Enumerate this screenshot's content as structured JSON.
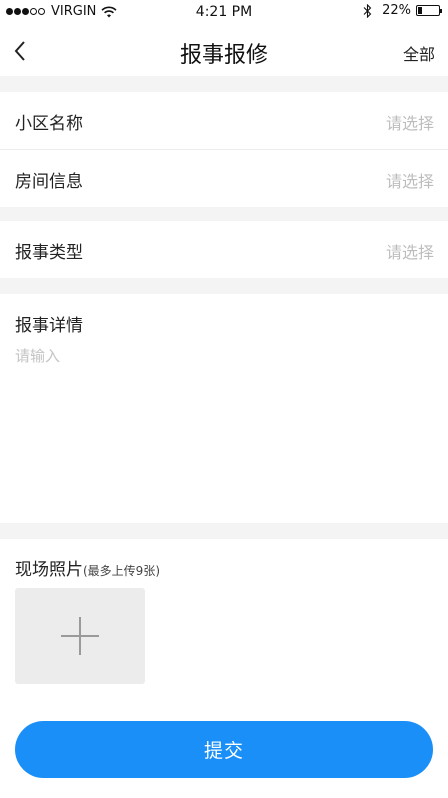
{
  "status_bar": {
    "carrier": "VIRGIN",
    "time": "4:21 PM",
    "battery": "22%",
    "battery_level": 0.22,
    "signal_bars_filled": 3,
    "signal_bars_total": 5,
    "icons": [
      "wifi-icon",
      "bluetooth-icon",
      "battery-icon"
    ]
  },
  "nav": {
    "back_icon": "chevron-left-icon",
    "title": "报事报修",
    "right_label": "全部"
  },
  "form": {
    "community": {
      "label": "小区名称",
      "value": "请选择"
    },
    "room": {
      "label": "房间信息",
      "value": "请选择"
    },
    "type": {
      "label": "报事类型",
      "value": "请选择"
    },
    "details": {
      "label": "报事详情",
      "placeholder": "请输入"
    },
    "photos": {
      "label": "现场照片",
      "hint": "(最多上传9张)",
      "add_icon": "plus-icon"
    }
  },
  "submit_label": "提交",
  "colors": {
    "accent": "#1a8ff7",
    "section_gap": "#f4f4f4",
    "placeholder": "#bdbdbd",
    "photo_tile": "#ececec"
  }
}
